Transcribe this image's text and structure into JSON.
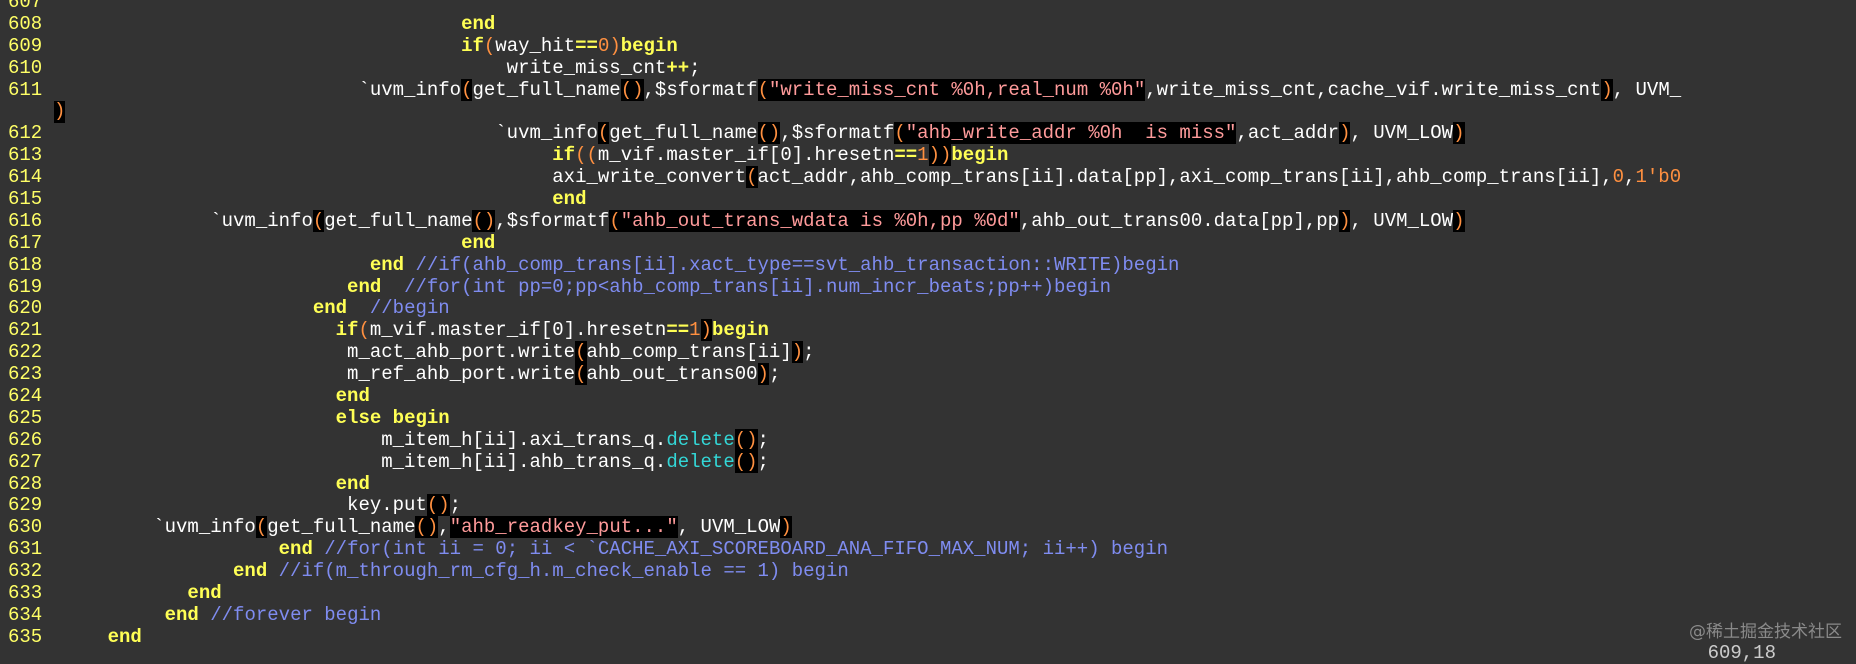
{
  "editor": {
    "colors": {
      "background": "#333333",
      "line_number": "#ffff66",
      "keyword": "#ffff55",
      "comment": "#7f8cf0",
      "string": "#ff9b9b",
      "paren": "#ff9040",
      "method": "#33d7d7"
    },
    "lines": [
      {
        "num": "607",
        "tokens": [],
        "overflow": ""
      },
      {
        "num": "608",
        "tokens": [
          {
            "t": "                                   "
          },
          {
            "t": "end",
            "c": "kw"
          }
        ]
      },
      {
        "num": "609",
        "tokens": [
          {
            "t": "                                   "
          },
          {
            "t": "if",
            "c": "kw"
          },
          {
            "t": "(",
            "c": "op"
          },
          {
            "t": "way_hit"
          },
          {
            "t": "==",
            "c": "kw"
          },
          {
            "t": "0",
            "c": "op"
          },
          {
            "t": ")",
            "c": "op"
          },
          {
            "t": "begin",
            "c": "kw"
          }
        ]
      },
      {
        "num": "610",
        "tokens": [
          {
            "t": "                                       write_miss_cnt"
          },
          {
            "t": "++",
            "c": "kw"
          },
          {
            "t": ";"
          }
        ]
      },
      {
        "num": "611",
        "tokens": [
          {
            "t": "                          `uvm_info"
          },
          {
            "t": "(",
            "c": "hp"
          },
          {
            "t": "get_full_name"
          },
          {
            "t": "()",
            "c": "hp"
          },
          {
            "t": ",$sformatf"
          },
          {
            "t": "(",
            "c": "hp"
          },
          {
            "t": "\"write_miss_cnt %0h,real_num %0h\"",
            "c": "st hb"
          },
          {
            "t": ",write_miss_cnt,cache_vif.write_miss_cnt"
          },
          {
            "t": ")",
            "c": "hp"
          },
          {
            "t": ", UVM_"
          }
        ]
      },
      {
        "num": "",
        "tokens": [],
        "overflow": ")"
      },
      {
        "num": "612",
        "tokens": [
          {
            "t": "                                      `uvm_info"
          },
          {
            "t": "(",
            "c": "hp"
          },
          {
            "t": "get_full_name"
          },
          {
            "t": "()",
            "c": "hp"
          },
          {
            "t": ",$sformatf"
          },
          {
            "t": "(",
            "c": "hp"
          },
          {
            "t": "\"ahb_write_addr %0h  is miss\"",
            "c": "st hb"
          },
          {
            "t": ",act_addr"
          },
          {
            "t": ")",
            "c": "hp"
          },
          {
            "t": ", UVM_LOW"
          },
          {
            "t": ")",
            "c": "hp"
          }
        ]
      },
      {
        "num": "613",
        "tokens": [
          {
            "t": "                                           "
          },
          {
            "t": "if",
            "c": "kw"
          },
          {
            "t": "((",
            "c": "op"
          },
          {
            "t": "m_vif.master_if[0].hresetn"
          },
          {
            "t": "==",
            "c": "kw"
          },
          {
            "t": "1",
            "c": "op"
          },
          {
            "t": "))",
            "c": "hp"
          },
          {
            "t": "begin",
            "c": "kw"
          }
        ]
      },
      {
        "num": "614",
        "tokens": [
          {
            "t": "                                           axi_write_convert"
          },
          {
            "t": "(",
            "c": "hp"
          },
          {
            "t": "act_addr,ahb_comp_trans[ii].data[pp],axi_comp_trans[ii],ahb_comp_trans[ii],"
          },
          {
            "t": "0",
            "c": "op"
          },
          {
            "t": ","
          },
          {
            "t": "1'b0",
            "c": "op"
          }
        ]
      },
      {
        "num": "615",
        "tokens": [
          {
            "t": "                                           "
          },
          {
            "t": "end",
            "c": "kw"
          }
        ]
      },
      {
        "num": "616",
        "tokens": [
          {
            "t": "             `uvm_info"
          },
          {
            "t": "(",
            "c": "hp"
          },
          {
            "t": "get_full_name"
          },
          {
            "t": "()",
            "c": "hp"
          },
          {
            "t": ",$sformatf"
          },
          {
            "t": "(",
            "c": "hp"
          },
          {
            "t": "\"ahb_out_trans_wdata is %0h,pp %0d\"",
            "c": "st hb"
          },
          {
            "t": ",ahb_out_trans00.data[pp],pp"
          },
          {
            "t": ")",
            "c": "hp"
          },
          {
            "t": ", UVM_LOW"
          },
          {
            "t": ")",
            "c": "hp"
          }
        ]
      },
      {
        "num": "617",
        "tokens": [
          {
            "t": "                                   "
          },
          {
            "t": "end",
            "c": "kw"
          }
        ]
      },
      {
        "num": "618",
        "tokens": [
          {
            "t": "                           "
          },
          {
            "t": "end",
            "c": "kw"
          },
          {
            "t": " "
          },
          {
            "t": "//if(ahb_comp_trans[ii].xact_type==svt_ahb_transaction::WRITE)begin",
            "c": "cm"
          }
        ]
      },
      {
        "num": "619",
        "tokens": [
          {
            "t": "                         "
          },
          {
            "t": "end",
            "c": "kw"
          },
          {
            "t": "  "
          },
          {
            "t": "//for(int pp=0;pp<ahb_comp_trans[ii].num_incr_beats;pp++)begin",
            "c": "cm"
          }
        ]
      },
      {
        "num": "620",
        "tokens": [
          {
            "t": "                      "
          },
          {
            "t": "end",
            "c": "kw"
          },
          {
            "t": "  "
          },
          {
            "t": "//begin",
            "c": "cm"
          }
        ]
      },
      {
        "num": "621",
        "tokens": [
          {
            "t": "                        "
          },
          {
            "t": "if",
            "c": "kw"
          },
          {
            "t": "(",
            "c": "op"
          },
          {
            "t": "m_vif.master_if[0].hresetn"
          },
          {
            "t": "==",
            "c": "kw"
          },
          {
            "t": "1",
            "c": "op"
          },
          {
            "t": ")",
            "c": "hp"
          },
          {
            "t": "begin",
            "c": "kw"
          }
        ]
      },
      {
        "num": "622",
        "tokens": [
          {
            "t": "                         m_act_ahb_port.write"
          },
          {
            "t": "(",
            "c": "hp"
          },
          {
            "t": "ahb_comp_trans[ii]"
          },
          {
            "t": ")",
            "c": "hp"
          },
          {
            "t": ";"
          }
        ]
      },
      {
        "num": "623",
        "tokens": [
          {
            "t": "                         m_ref_ahb_port.write"
          },
          {
            "t": "(",
            "c": "hp"
          },
          {
            "t": "ahb_out_trans00"
          },
          {
            "t": ")",
            "c": "hp"
          },
          {
            "t": ";"
          }
        ]
      },
      {
        "num": "624",
        "tokens": [
          {
            "t": "                        "
          },
          {
            "t": "end",
            "c": "kw"
          }
        ]
      },
      {
        "num": "625",
        "tokens": [
          {
            "t": "                        "
          },
          {
            "t": "else begin",
            "c": "kw"
          }
        ]
      },
      {
        "num": "626",
        "tokens": [
          {
            "t": "                            m_item_h[ii].axi_trans_q."
          },
          {
            "t": "delete",
            "c": "mt"
          },
          {
            "t": "()",
            "c": "hp"
          },
          {
            "t": ";"
          }
        ]
      },
      {
        "num": "627",
        "tokens": [
          {
            "t": "                            m_item_h[ii].ahb_trans_q."
          },
          {
            "t": "delete",
            "c": "mt"
          },
          {
            "t": "()",
            "c": "hp"
          },
          {
            "t": ";"
          }
        ]
      },
      {
        "num": "628",
        "tokens": [
          {
            "t": "                        "
          },
          {
            "t": "end",
            "c": "kw"
          }
        ]
      },
      {
        "num": "629",
        "tokens": [
          {
            "t": "                         key.put"
          },
          {
            "t": "()",
            "c": "hp"
          },
          {
            "t": ";"
          }
        ]
      },
      {
        "num": "630",
        "tokens": [
          {
            "t": "        `uvm_info"
          },
          {
            "t": "(",
            "c": "hp"
          },
          {
            "t": "get_full_name"
          },
          {
            "t": "()",
            "c": "hp"
          },
          {
            "t": ","
          },
          {
            "t": "\"ahb_readkey_put...\"",
            "c": "st hb"
          },
          {
            "t": ", UVM_LOW"
          },
          {
            "t": ")",
            "c": "hp"
          }
        ]
      },
      {
        "num": "631",
        "tokens": [
          {
            "t": "                   "
          },
          {
            "t": "end",
            "c": "kw"
          },
          {
            "t": " "
          },
          {
            "t": "//for(int ii = 0; ii < `CACHE_AXI_SCOREBOARD_ANA_FIFO_MAX_NUM; ii++) begin",
            "c": "cm"
          }
        ]
      },
      {
        "num": "632",
        "tokens": [
          {
            "t": "               "
          },
          {
            "t": "end",
            "c": "kw"
          },
          {
            "t": " "
          },
          {
            "t": "//if(m_through_rm_cfg_h.m_check_enable == 1) begin",
            "c": "cm"
          }
        ]
      },
      {
        "num": "633",
        "tokens": [
          {
            "t": "           "
          },
          {
            "t": "end",
            "c": "kw"
          }
        ]
      },
      {
        "num": "634",
        "tokens": [
          {
            "t": "         "
          },
          {
            "t": "end",
            "c": "kw"
          },
          {
            "t": " "
          },
          {
            "t": "//forever begin",
            "c": "cm"
          }
        ]
      },
      {
        "num": "635",
        "tokens": [
          {
            "t": "    "
          },
          {
            "t": "end",
            "c": "kw"
          }
        ]
      }
    ]
  },
  "watermark": "@稀土掘金技术社区",
  "status": {
    "position": "609,18"
  }
}
